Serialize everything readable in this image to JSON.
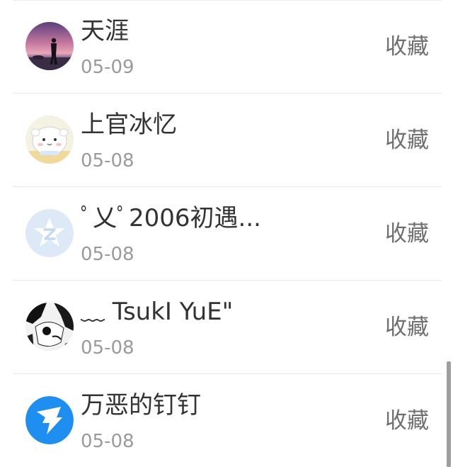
{
  "items": [
    {
      "name": "天涯",
      "date": "05-09",
      "action": "收藏",
      "avatar": "sunset-silhouette-avatar"
    },
    {
      "name": "上官冰忆",
      "date": "05-08",
      "action": "收藏",
      "avatar": "cute-creature-avatar"
    },
    {
      "name": "ﾟ乂ﾟ2006初遇...",
      "date": "05-08",
      "action": "收藏",
      "avatar": "qzone-star-avatar"
    },
    {
      "name": "﹏ TsukI YuE\"",
      "date": "05-08",
      "action": "收藏",
      "avatar": "monochrome-face-avatar"
    },
    {
      "name": "万恶的钉钉",
      "date": "05-08",
      "action": "收藏",
      "avatar": "dingtalk-logo-avatar"
    }
  ],
  "colors": {
    "name_text": "#333333",
    "date_text": "#9a9a9a",
    "action_text": "#6f6f6f",
    "divider": "#e6e6e6",
    "dingtalk_blue": "#1f8ef1"
  }
}
